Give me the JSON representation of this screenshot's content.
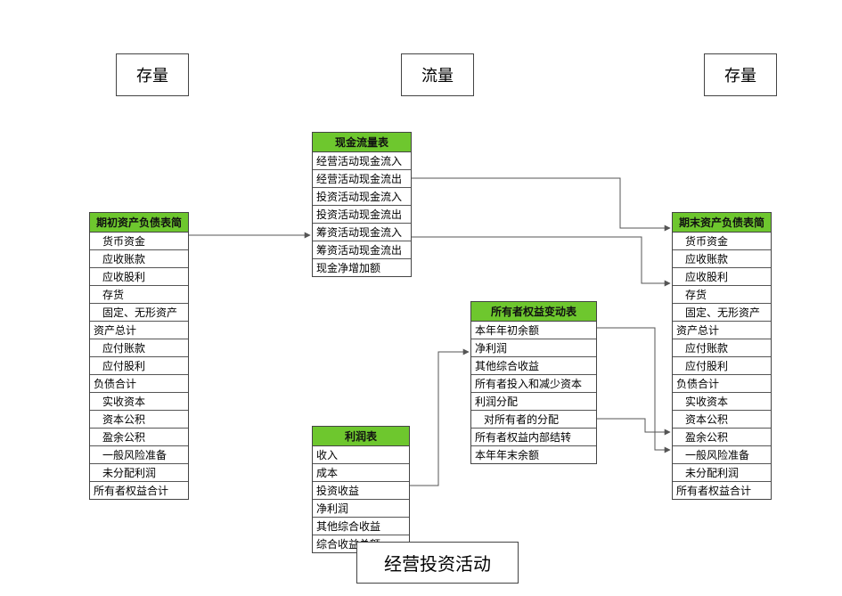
{
  "labels": {
    "stock_left": "存量",
    "flow": "流量",
    "stock_right": "存量",
    "bottom": "经营投资活动"
  },
  "tables": {
    "initial_bs": {
      "title": "期初资产负债表简",
      "rows": [
        {
          "t": "货币资金",
          "indent": true
        },
        {
          "t": "应收账款",
          "indent": true
        },
        {
          "t": "应收股利",
          "indent": true
        },
        {
          "t": "存货",
          "indent": true
        },
        {
          "t": "固定、无形资产",
          "indent": true
        },
        {
          "t": "资产总计"
        },
        {
          "t": "应付账款",
          "indent": true
        },
        {
          "t": "应付股利",
          "indent": true
        },
        {
          "t": "负债合计"
        },
        {
          "t": "实收资本",
          "indent": true
        },
        {
          "t": "资本公积",
          "indent": true
        },
        {
          "t": "盈余公积",
          "indent": true
        },
        {
          "t": "一般风险准备",
          "indent": true
        },
        {
          "t": "未分配利润",
          "indent": true
        },
        {
          "t": "所有者权益合计"
        }
      ]
    },
    "ending_bs": {
      "title": "期末资产负债表简",
      "rows": [
        {
          "t": "货币资金",
          "indent": true
        },
        {
          "t": "应收账款",
          "indent": true
        },
        {
          "t": "应收股利",
          "indent": true
        },
        {
          "t": "存货",
          "indent": true
        },
        {
          "t": "固定、无形资产",
          "indent": true
        },
        {
          "t": "资产总计"
        },
        {
          "t": "应付账款",
          "indent": true
        },
        {
          "t": "应付股利",
          "indent": true
        },
        {
          "t": "负债合计"
        },
        {
          "t": "实收资本",
          "indent": true
        },
        {
          "t": "资本公积",
          "indent": true
        },
        {
          "t": "盈余公积",
          "indent": true
        },
        {
          "t": "一般风险准备",
          "indent": true
        },
        {
          "t": "未分配利润",
          "indent": true
        },
        {
          "t": "所有者权益合计"
        }
      ]
    },
    "cashflow": {
      "title": "现金流量表",
      "rows": [
        {
          "t": "经营活动现金流入"
        },
        {
          "t": "经营活动现金流出"
        },
        {
          "t": "投资活动现金流入"
        },
        {
          "t": "投资活动现金流出"
        },
        {
          "t": "筹资活动现金流入"
        },
        {
          "t": "筹资活动现金流出"
        },
        {
          "t": "现金净增加额"
        }
      ]
    },
    "equity": {
      "title": "所有者权益变动表",
      "rows": [
        {
          "t": "本年年初余额"
        },
        {
          "t": "净利润"
        },
        {
          "t": "其他综合收益"
        },
        {
          "t": "所有者投入和减少资本"
        },
        {
          "t": "利润分配"
        },
        {
          "t": "对所有者的分配",
          "indent": true
        },
        {
          "t": "所有者权益内部结转"
        },
        {
          "t": "本年年末余额"
        }
      ]
    },
    "income": {
      "title": "利润表",
      "rows": [
        {
          "t": "收入"
        },
        {
          "t": "成本"
        },
        {
          "t": "投资收益"
        },
        {
          "t": "净利润"
        },
        {
          "t": "其他综合收益"
        },
        {
          "t": "综合收益总额"
        }
      ]
    }
  }
}
